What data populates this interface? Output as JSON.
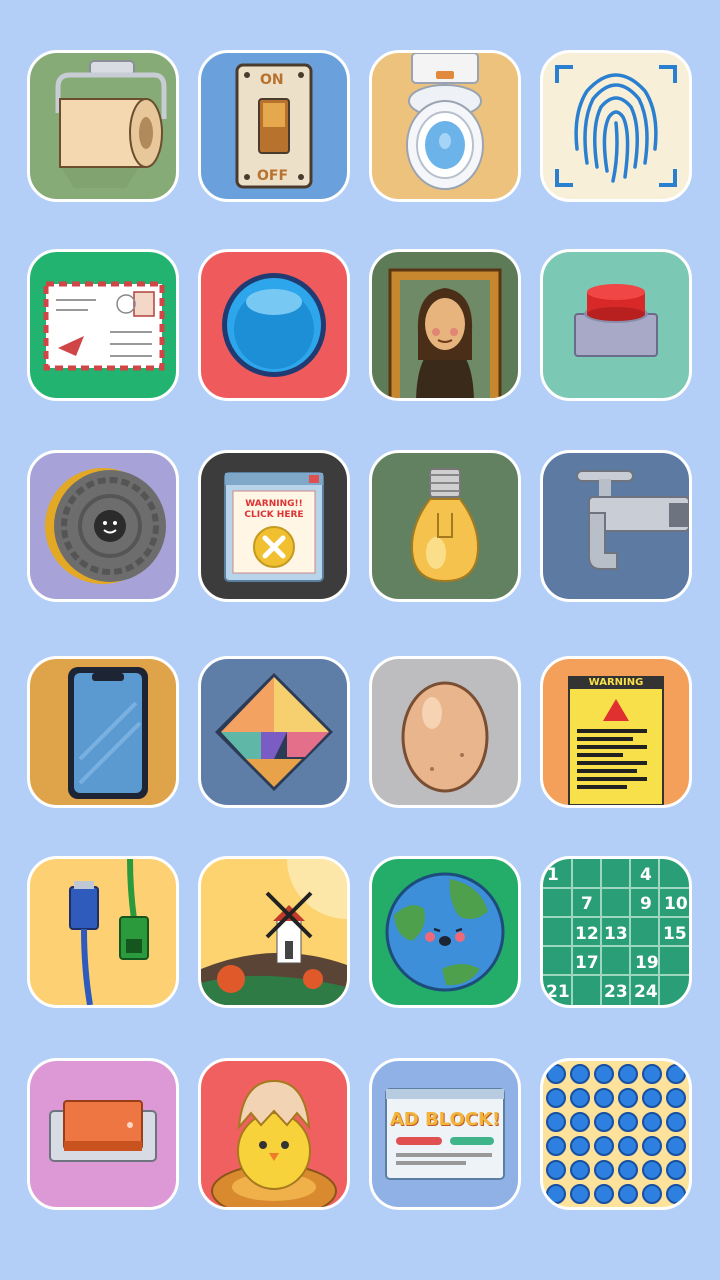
{
  "screen": "level-select",
  "tiles": [
    {
      "id": "toilet-paper",
      "bg": "#86ab77"
    },
    {
      "id": "light-switch",
      "bg": "#6aa0dc",
      "on_label": "ON",
      "off_label": "OFF"
    },
    {
      "id": "toilet",
      "bg": "#ecc27c"
    },
    {
      "id": "fingerprint",
      "bg": "#f7efd8"
    },
    {
      "id": "envelope",
      "bg": "#22b370"
    },
    {
      "id": "blue-button",
      "bg": "#ef5a5c"
    },
    {
      "id": "mona-lisa",
      "bg": "#5e7b58"
    },
    {
      "id": "red-button",
      "bg": "#7bc8b4"
    },
    {
      "id": "manhole",
      "bg": "#a7a3d8"
    },
    {
      "id": "popup-ad",
      "bg": "#3c3c3c",
      "popup_line1": "WARNING!!",
      "popup_line2": "CLICK HERE"
    },
    {
      "id": "light-bulb",
      "bg": "#628160"
    },
    {
      "id": "faucet",
      "bg": "#5d7aa3"
    },
    {
      "id": "smartphone",
      "bg": "#dfa349"
    },
    {
      "id": "tangram",
      "bg": "#5e7ea7"
    },
    {
      "id": "egg",
      "bg": "#bdbdbf"
    },
    {
      "id": "warning-sign",
      "bg": "#f4a05a",
      "sign_title": "WARNING"
    },
    {
      "id": "usb-cable",
      "bg": "#fdd074"
    },
    {
      "id": "windmill",
      "bg": "#fcd36f"
    },
    {
      "id": "earth",
      "bg": "#23ad68"
    },
    {
      "id": "number-grid",
      "bg": "#2a9e76",
      "numbers": [
        "1",
        "4",
        "7",
        "9",
        "10",
        "12",
        "13",
        "15",
        "17",
        "19",
        "21",
        "23",
        "24"
      ]
    },
    {
      "id": "rocker-switch",
      "bg": "#dd98d6"
    },
    {
      "id": "hatching-chick",
      "bg": "#f06060"
    },
    {
      "id": "ad-block",
      "bg": "#8fb1e5",
      "title": "AD BLOCK!"
    },
    {
      "id": "pop-it",
      "bg": "#fde29b"
    }
  ]
}
